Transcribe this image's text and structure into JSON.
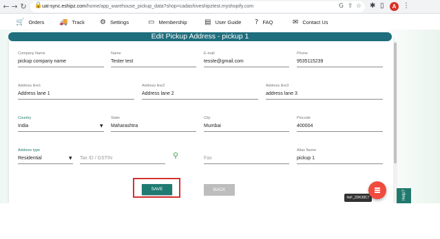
{
  "browser": {
    "url_host": "uat-sync.eshipz.com",
    "url_path": "/home/app_warehouse_pickup_data?shop=cadashiveshipztest.myshopify.com",
    "profile_initial": "A"
  },
  "nav": {
    "items": [
      {
        "label": "Orders",
        "icon": "cart-icon"
      },
      {
        "label": "Track",
        "icon": "truck-icon"
      },
      {
        "label": "Settings",
        "icon": "gear-icon"
      },
      {
        "label": "Membership",
        "icon": "card-icon"
      },
      {
        "label": "User Guide",
        "icon": "document-icon"
      },
      {
        "label": "FAQ",
        "icon": "question-icon"
      },
      {
        "label": "Contact Us",
        "icon": "mail-icon"
      }
    ]
  },
  "page": {
    "title": "Edit Pickup Address - pickup 1"
  },
  "form": {
    "company_name": {
      "label": "Company Name",
      "value": "pickup company name"
    },
    "name": {
      "label": "Name",
      "value": "Tester test"
    },
    "email": {
      "label": "E-mail",
      "value": "tesste@gmail.com"
    },
    "phone": {
      "label": "Phone",
      "value": "9535115239"
    },
    "address1": {
      "label": "Address line1",
      "value": "Address lane 1"
    },
    "address2": {
      "label": "Address line2",
      "value": "Address lane 2"
    },
    "address3": {
      "label": "Address line3",
      "value": "address lane 3"
    },
    "country": {
      "label": "Country",
      "value": "India"
    },
    "state": {
      "label": "State",
      "value": "Maharashtra"
    },
    "city": {
      "label": "City",
      "value": "Mumbai"
    },
    "pincode": {
      "label": "Pincode",
      "value": "400004"
    },
    "address_type": {
      "label": "Address type",
      "value": "Residential"
    },
    "tax_id": {
      "placeholder": "Tax ID / GSTIN"
    },
    "fax": {
      "placeholder": "Fax"
    },
    "alias_name": {
      "label": "Alias Name",
      "value": "pickup 1"
    }
  },
  "buttons": {
    "save": "SAVE",
    "back": "BACK"
  },
  "tooltip": "#eF_2DK39C7",
  "help_tab": "Help?"
}
